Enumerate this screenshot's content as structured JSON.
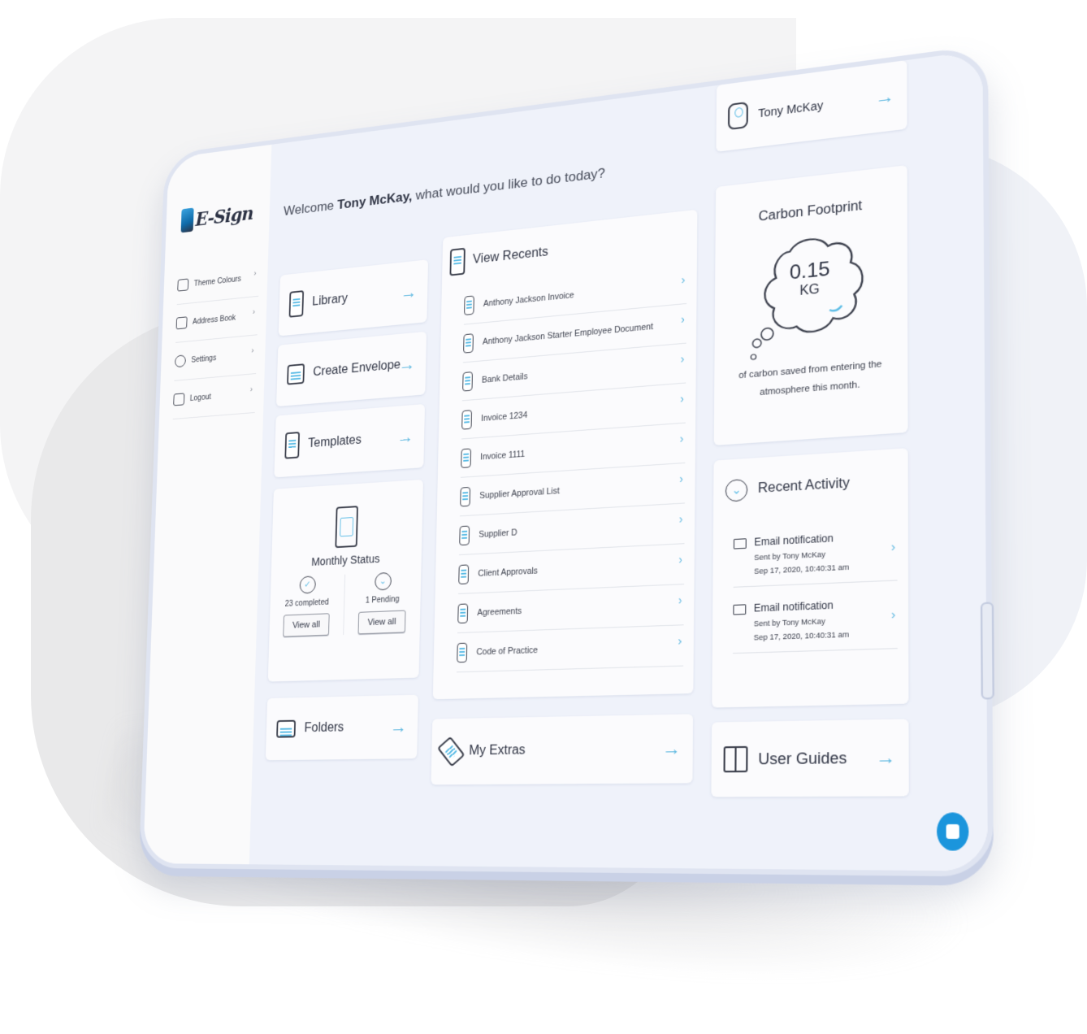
{
  "app": {
    "logo_text": "E-Sign"
  },
  "sidebar": {
    "items": [
      {
        "label": "Theme Colours",
        "icon": "palette-icon"
      },
      {
        "label": "Address Book",
        "icon": "address-book-icon"
      },
      {
        "label": "Settings",
        "icon": "gear-icon"
      },
      {
        "label": "Logout",
        "icon": "logout-icon"
      }
    ],
    "chevron": "›"
  },
  "header": {
    "welcome_prefix": "Welcome ",
    "user_name": "Tony McKay,",
    "welcome_suffix": " what would you like to do today?"
  },
  "cards": {
    "library": "Library",
    "create_envelope": "Create Envelope",
    "templates": "Templates",
    "folders": "Folders",
    "my_extras": "My Extras",
    "user_guides": "User Guides",
    "arrow": "→"
  },
  "monthly_status": {
    "title": "Monthly Status",
    "completed": {
      "label": "23 completed",
      "button": "View all",
      "icon": "✓"
    },
    "pending": {
      "label": "1 Pending",
      "button": "View all",
      "icon": "⌄"
    }
  },
  "recents": {
    "title": "View Recents",
    "chevron": "›",
    "items": [
      "Anthony Jackson Invoice",
      "Anthony Jackson Starter Employee Document",
      "Bank Details",
      "Invoice 1234",
      "Invoice 1111",
      "Supplier Approval List",
      "Supplier D",
      "Client Approvals",
      "Agreements",
      "Code of Practice"
    ]
  },
  "profile": {
    "name": "Tony McKay"
  },
  "carbon": {
    "title": "Carbon Footprint",
    "value": "0.15",
    "unit": "KG",
    "description": "of carbon saved from entering the atmosphere this month."
  },
  "activity": {
    "title": "Recent Activity",
    "chevron": "›",
    "items": [
      {
        "title": "Email notification",
        "sender": "Sent by Tony McKay",
        "time": "Sep 17, 2020, 10:40:31 am"
      },
      {
        "title": "Email notification",
        "sender": "Sent by Tony McKay",
        "time": "Sep 17, 2020, 10:40:31 am"
      }
    ]
  },
  "colors": {
    "accent": "#5cb7e0",
    "chat_button": "#1b95dc",
    "text": "#2f3444",
    "panel_bg": "#eff2fa"
  }
}
